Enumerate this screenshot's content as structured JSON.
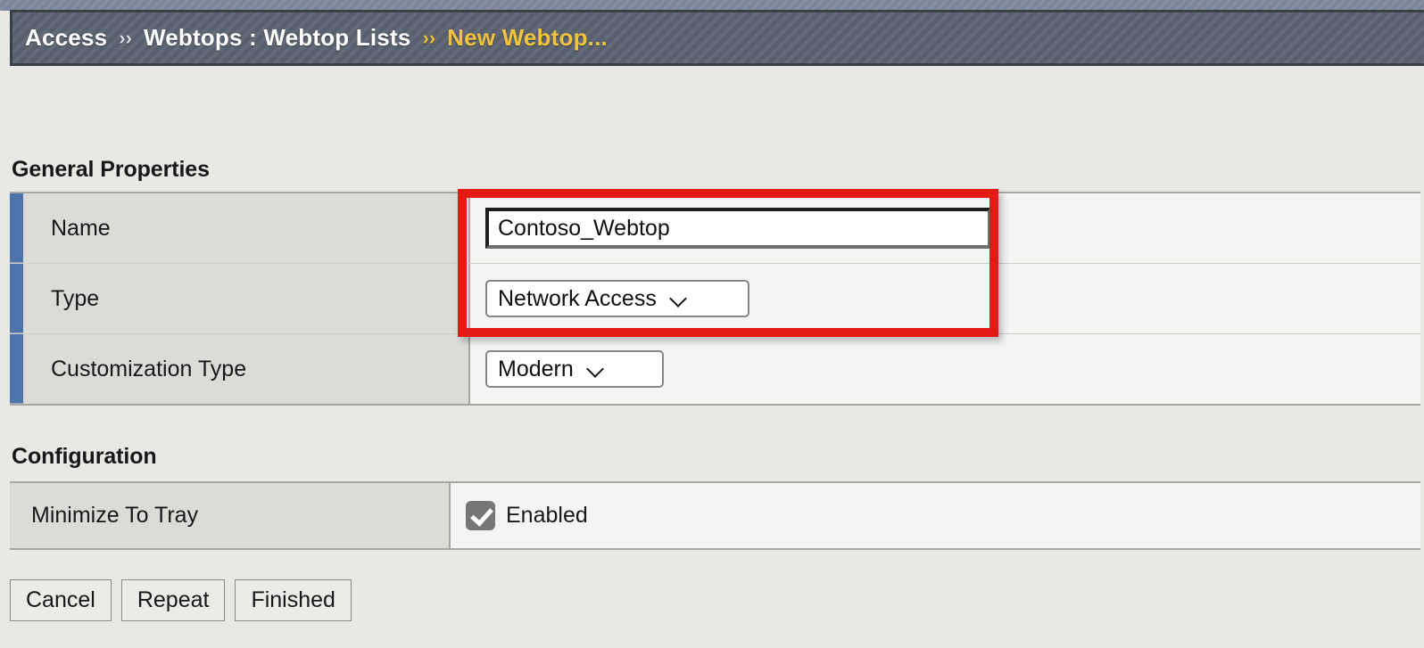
{
  "header": {
    "breadcrumb": [
      {
        "label": "Access",
        "current": false
      },
      {
        "label": "Webtops : Webtop Lists",
        "current": false
      },
      {
        "label": "New Webtop...",
        "current": true
      }
    ],
    "separator": "››",
    "colors": {
      "panel_bg": "#5b6372",
      "top_strip": "#7e8a9e",
      "border": "#3b3f46",
      "text": "#ffffff",
      "current_text": "#f5c33b"
    }
  },
  "sections": {
    "general": {
      "title": "General Properties",
      "rows": [
        {
          "label": "Name",
          "control": "text",
          "value": "Contoso_Webtop",
          "placeholder": ""
        },
        {
          "label": "Type",
          "control": "select",
          "value": "Network Access"
        },
        {
          "label": "Customization Type",
          "control": "select",
          "value": "Modern"
        }
      ]
    },
    "configuration": {
      "title": "Configuration",
      "rows": [
        {
          "label": "Minimize To Tray",
          "control": "checkbox",
          "checked": true,
          "value": "Enabled"
        }
      ]
    }
  },
  "buttons": [
    {
      "label": "Cancel"
    },
    {
      "label": "Repeat"
    },
    {
      "label": "Finished"
    }
  ],
  "annotation": {
    "color": "#e31b14",
    "target": "Name and Type fields"
  },
  "icons": {
    "chevron_down": "chevron-down-icon",
    "checkmark": "checkmark-icon"
  },
  "colors": {
    "page_bg": "#eae8e4",
    "label_cell": "#dcdbd8",
    "value_cell": "#f5f4f2",
    "accent_bar": "#4d74a8",
    "table_border": "#a6a6a4"
  }
}
